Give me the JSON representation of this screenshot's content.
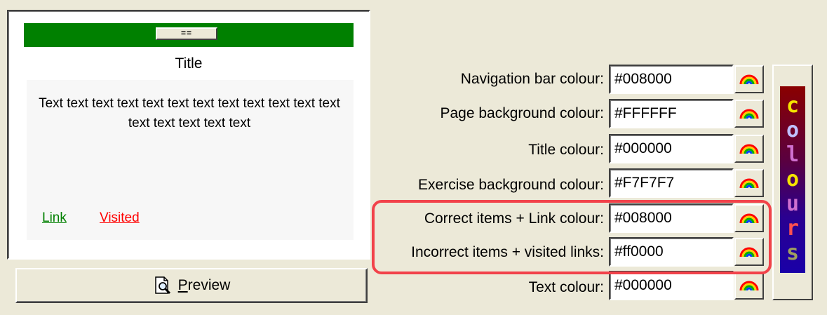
{
  "preview": {
    "nav_button_label": "==",
    "title": "Title",
    "exercise_text": "Text text text text text text text text text text text text text text text text text",
    "link_text": "Link",
    "visited_text": "Visited",
    "button_label_underlined": "P",
    "button_label_rest": "review"
  },
  "fields": [
    {
      "label": "Navigation bar colour:",
      "value": "#008000"
    },
    {
      "label": "Page background colour:",
      "value": "#FFFFFF"
    },
    {
      "label": "Title colour:",
      "value": "#000000"
    },
    {
      "label": "Exercise background colour:",
      "value": "#F7F7F7"
    },
    {
      "label": "Correct items + Link colour:",
      "value": "#008000"
    },
    {
      "label": "Incorrect items + visited links:",
      "value": "#ff0000"
    },
    {
      "label": "Text colour:",
      "value": "#000000"
    }
  ],
  "banner": {
    "letters": [
      "c",
      "o",
      "l",
      "o",
      "u",
      "r",
      "s"
    ],
    "letter_colors": [
      "#f5e400",
      "#c0c0ff",
      "#d070d0",
      "#f5e400",
      "#d070d0",
      "#ff5050",
      "#a0a060"
    ]
  },
  "colors": {
    "nav_bar": "#008000",
    "highlight": "#f2424a",
    "link": "#008000",
    "visited": "#ff0000"
  },
  "icons": {
    "preview_button": "magnifier-document-icon",
    "colour_picker": "rainbow-icon"
  }
}
